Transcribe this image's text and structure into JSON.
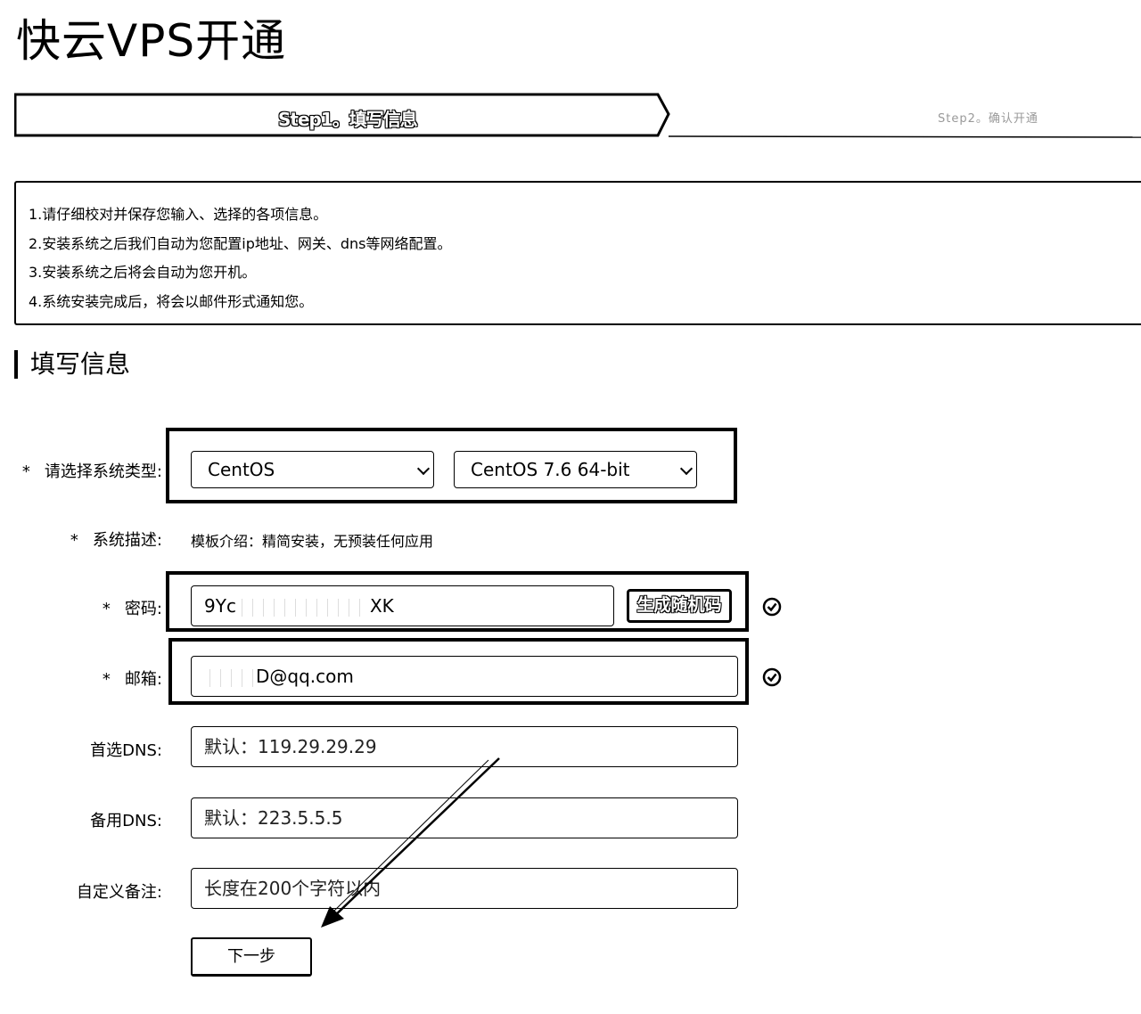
{
  "page": {
    "title": "快云VPS开通"
  },
  "steps": [
    {
      "label": "Step1。填写信息",
      "active": true
    },
    {
      "label": "Step2。确认开通",
      "active": false
    }
  ],
  "notice": {
    "lines": [
      "1.请仔细校对并保存您输入、选择的各项信息。",
      "2.安装系统之后我们自动为您配置ip地址、网关、dns等网络配置。",
      "3.安装系统之后将会自动为您开机。",
      "4.系统安装完成后，将会以邮件形式通知您。"
    ]
  },
  "section": {
    "title": "填写信息"
  },
  "form": {
    "os_type": {
      "required": "*",
      "label": "请选择系统类型:",
      "os_family": "CentOS",
      "os_version": "CentOS 7.6 64-bit"
    },
    "description": {
      "required": "*",
      "label": "系统描述:",
      "value": "模板介绍：精简安装，无预装任何应用"
    },
    "password": {
      "required": "*",
      "label": "密码:",
      "value_prefix": "9Yc",
      "value_suffix": "XK",
      "generate_label": "生成随机码",
      "status_icon": "check-circle-icon"
    },
    "email": {
      "required": "*",
      "label": "邮箱:",
      "value_suffix": "D@qq.com",
      "status_icon": "check-circle-icon"
    },
    "dns_primary": {
      "label": "首选DNS:",
      "placeholder": "默认：119.29.29.29"
    },
    "dns_secondary": {
      "label": "备用DNS:",
      "placeholder": "默认：223.5.5.5"
    },
    "note": {
      "label": "自定义备注:",
      "placeholder": "长度在200个字符以内"
    },
    "next_label": "下一步"
  },
  "colors": {
    "text": "#000000",
    "background": "#ffffff",
    "border": "#000000"
  }
}
